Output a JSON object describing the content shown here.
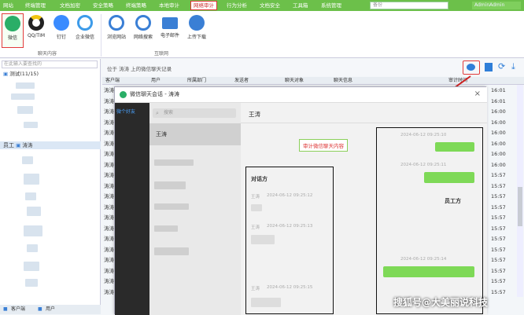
{
  "topnav": {
    "items": [
      "网站",
      "终端管理",
      "文档加密",
      "安全策略",
      "终端策略",
      "本地审计",
      "网络审计",
      "行为分析",
      "文档安全",
      "工具箱",
      "系统管理"
    ],
    "active_index": 6,
    "search_placeholder": "备份",
    "user_label": "AdminAdmin"
  },
  "ribbon": {
    "buttons": [
      {
        "label": "微信",
        "icon": "wechat-icon",
        "color": "#2aae67",
        "highlighted": true
      },
      {
        "label": "QQ/TIM",
        "icon": "qq-icon",
        "color": "#222"
      },
      {
        "label": "钉钉",
        "icon": "dingtalk-icon",
        "color": "#3a8bff"
      },
      {
        "label": "企业微信",
        "icon": "wecom-icon",
        "color": "#3d9be9"
      },
      {
        "label": "浏览网站",
        "icon": "browser-icon",
        "color": "#3a7fd5"
      },
      {
        "label": "网络搜索",
        "icon": "search-globe-icon",
        "color": "#3a7fd5"
      },
      {
        "label": "电子邮件",
        "icon": "email-icon",
        "color": "#3a7fd5"
      },
      {
        "label": "上传下载",
        "icon": "upload-download-icon",
        "color": "#3a7fd5"
      }
    ],
    "group_labels": [
      "聊天内容",
      "互联网"
    ]
  },
  "tree": {
    "search_placeholder": "在此输入要查找的",
    "root_label": "测试(11/15)",
    "selected_label": "涛涛",
    "employee_label": "员工"
  },
  "main": {
    "breadcrumb": "位于 涛涛 上的微信聊天记录",
    "columns": [
      "客户端",
      "用户",
      "所属部门",
      "发送者",
      "聊天对象",
      "聊天信息",
      "审计时间"
    ],
    "rows": [
      {
        "client": "涛涛",
        "time": "16:01"
      },
      {
        "client": "涛涛",
        "time": "16:01"
      },
      {
        "client": "涛涛",
        "time": "16:00"
      },
      {
        "client": "涛涛",
        "time": "16:00"
      },
      {
        "client": "涛涛",
        "time": "16:00"
      },
      {
        "client": "涛涛",
        "time": "16:00"
      },
      {
        "client": "涛涛",
        "time": "16:00"
      },
      {
        "client": "涛涛",
        "time": "16:00"
      },
      {
        "client": "涛涛",
        "time": "15:57"
      },
      {
        "client": "涛涛",
        "time": "15:57"
      },
      {
        "client": "涛涛",
        "time": "15:57"
      },
      {
        "client": "涛涛",
        "time": "15:57"
      },
      {
        "client": "涛涛",
        "time": "15:57"
      },
      {
        "client": "涛涛",
        "time": "15:57"
      },
      {
        "client": "涛涛",
        "time": "15:57"
      },
      {
        "client": "涛涛",
        "time": "15:57"
      },
      {
        "client": "涛涛",
        "time": "15:57"
      },
      {
        "client": "涛涛",
        "time": "15:57"
      },
      {
        "client": "涛涛",
        "time": "15:57"
      },
      {
        "client": "涛涛",
        "time": "15:57"
      }
    ]
  },
  "chat": {
    "title": "微信聊天会话 - 涛涛",
    "friends_tab": "微个好友",
    "search_placeholder": "搜索",
    "first_contact": "王涛",
    "header_name": "王涛",
    "annotation_audit": "审计微信聊天内容",
    "annotation_party": "对话方",
    "annotation_employee": "员工方",
    "left_messages": [
      {
        "sender": "王涛",
        "time": "2024-06-12 09:25:12"
      },
      {
        "sender": "王涛",
        "time": "2024-06-12 09:25:13"
      },
      {
        "sender": "王涛",
        "time": "2024-06-12 09:25:15"
      }
    ],
    "right_messages": [
      {
        "time": "2024-06-12 09:25:10"
      },
      {
        "time": "2024-06-12 09:25:11"
      },
      {
        "time": "2024-06-12 09:25:14"
      }
    ]
  },
  "footer": {
    "tab1": "客户端",
    "tab2": "用户"
  },
  "watermark": "搜狐号@大美丽说科技"
}
